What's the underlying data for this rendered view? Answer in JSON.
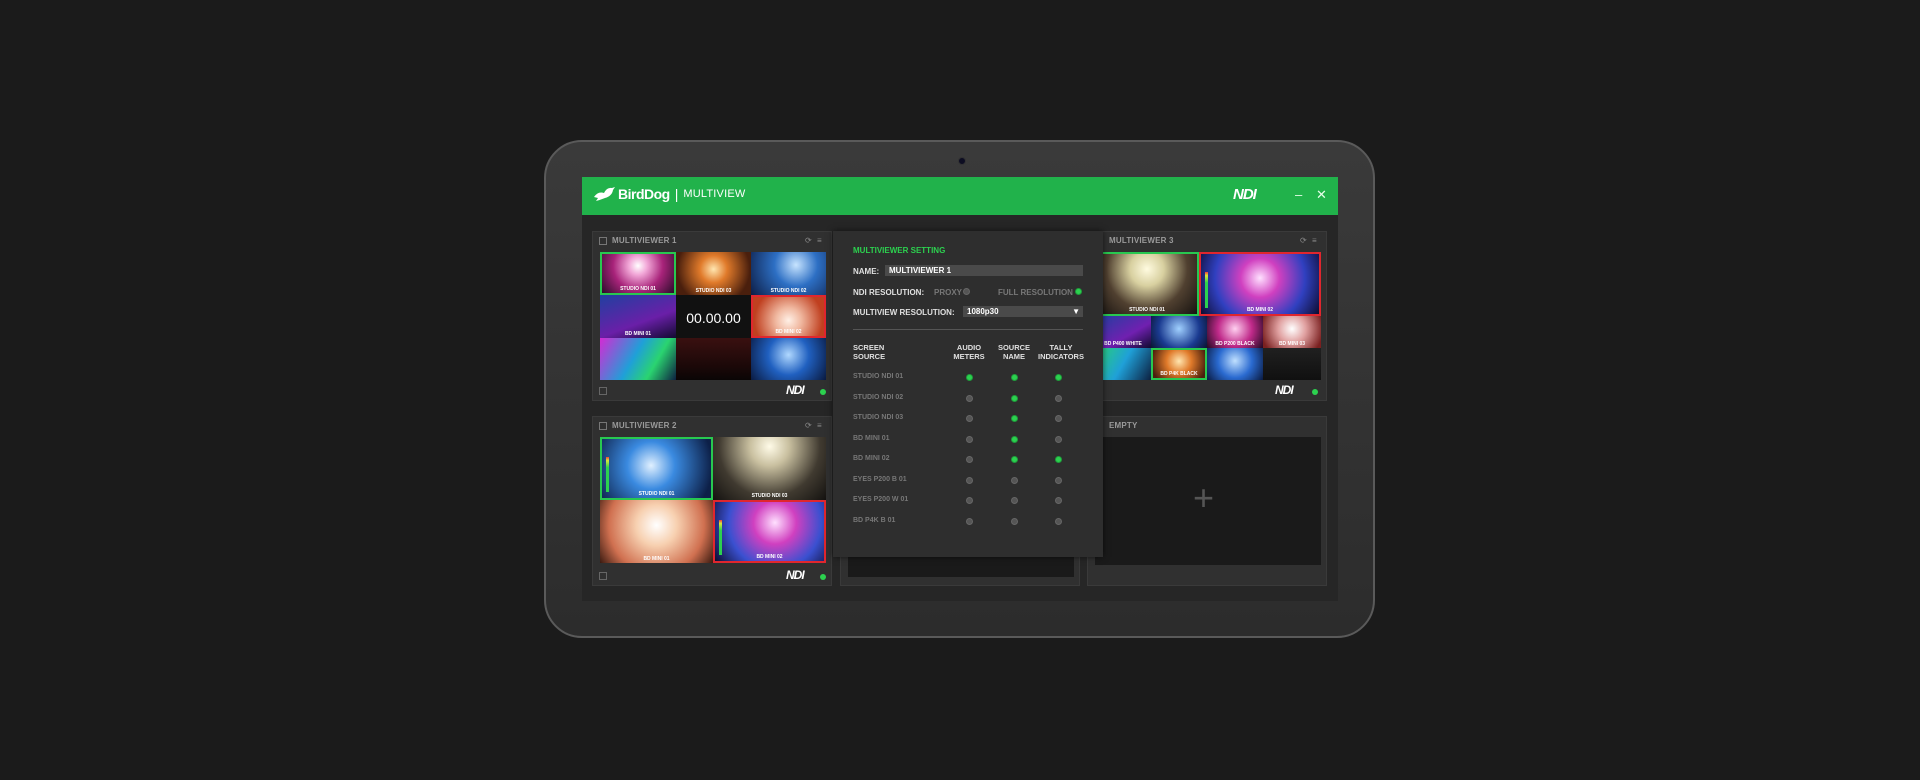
{
  "app": {
    "brand": "BirdDog",
    "separator": "|",
    "name": "MULTIVIEW",
    "ndi_logo": "NDI",
    "minimize": "–",
    "close": "✕"
  },
  "panels": [
    {
      "title": "MULTIVIEWER 1",
      "ndi": "NDI",
      "tiles": [
        "STUDIO NDI 01",
        "STUDIO NDI 03",
        "STUDIO NDI 02",
        "BD MINI 01",
        "BD MINI 02",
        "",
        "",
        ""
      ],
      "timer": "00.00.00"
    },
    {
      "title": "MULTIVIEWER 2",
      "ndi": "NDI",
      "tiles": [
        "STUDIO NDI 01",
        "STUDIO NDI 03",
        "BD MINI 01",
        "BD MINI 02"
      ]
    },
    {
      "title": "MULTIVIEWER 3",
      "ndi": "NDI",
      "tiles": [
        "STUDIO NDI 01",
        "BD MINI 02",
        "BD P400 WHITE",
        "BD P200 BLACK",
        "BD MINI 03",
        "BD P4K BLACK"
      ]
    },
    {
      "title": "EMPTY",
      "plus": "+"
    }
  ],
  "settings": {
    "title": "MULTIVIEWER SETTING",
    "name_label": "NAME:",
    "name_value": "MULTIVIEWER 1",
    "ndi_res_label": "NDI RESOLUTION:",
    "proxy_label": "PROXY",
    "full_label": "FULL RESOLUTION",
    "ndi_res_selected": "FULL RESOLUTION",
    "mv_res_label": "MULTIVIEW RESOLUTION:",
    "mv_res_value": "1080p30",
    "headers": {
      "source": [
        "SCREEN",
        "SOURCE"
      ],
      "audio": [
        "AUDIO",
        "METERS"
      ],
      "name": [
        "SOURCE",
        "NAME"
      ],
      "tally": [
        "TALLY",
        "INDICATORS"
      ]
    },
    "rows": [
      {
        "source": "STUDIO NDI 01",
        "audio": true,
        "name": true,
        "tally": true
      },
      {
        "source": "STUDIO NDI 02",
        "audio": false,
        "name": true,
        "tally": false
      },
      {
        "source": "STUDIO NDI 03",
        "audio": false,
        "name": true,
        "tally": false
      },
      {
        "source": "BD MINI 01",
        "audio": false,
        "name": true,
        "tally": false
      },
      {
        "source": "BD MINI 02",
        "audio": false,
        "name": true,
        "tally": true
      },
      {
        "source": "EYES P200 B 01",
        "audio": false,
        "name": false,
        "tally": false
      },
      {
        "source": "EYES P200 W 01",
        "audio": false,
        "name": false,
        "tally": false
      },
      {
        "source": "BD P4K B 01",
        "audio": false,
        "name": false,
        "tally": false
      }
    ]
  },
  "colors": {
    "accent": "#21b24b",
    "tally_live": "#28c850",
    "tally_preview": "#e0262e"
  }
}
